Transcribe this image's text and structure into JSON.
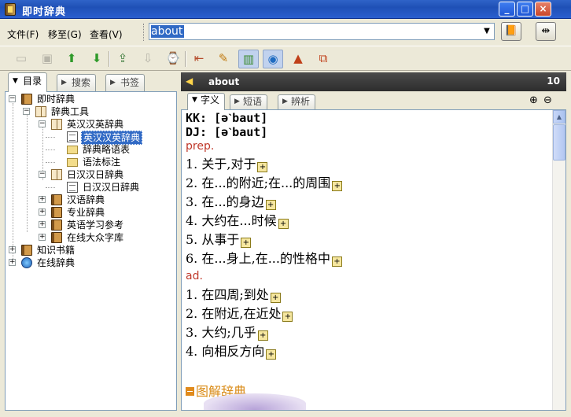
{
  "window": {
    "title": "即时辞典"
  },
  "menu": {
    "file": "文件(F)",
    "move": "移至(G)",
    "view": "查看(V)"
  },
  "search": {
    "value": "about"
  },
  "toolbar_icons": [
    "save-icon",
    "cut-icon",
    "up-arrow-icon",
    "down-arrow-icon",
    "export-icon",
    "import-icon",
    "history-icon",
    "find-icon",
    "note-icon",
    "book-view-icon",
    "globe-icon",
    "pdf-icon",
    "dictionary-manage-icon"
  ],
  "left_tabs": [
    "目录",
    "搜索",
    "书签"
  ],
  "tree": {
    "root": "即时辞典",
    "tools": "辞典工具",
    "ce_dict_group": "英汉汉英辞典",
    "ce_dict": "英汉汉英辞典",
    "abbrev": "辞典略语表",
    "grammar": "语法标注",
    "jp_group": "日汉汉日辞典",
    "jp_dict": "日汉汉日辞典",
    "cn_dict": "汉语辞典",
    "pro_dict": "专业辞典",
    "study": "英语学习参考",
    "online_lib": "在线大众字库",
    "knowledge": "知识书籍",
    "online": "在线辞典"
  },
  "entry": {
    "word": "about",
    "count": "10",
    "tabs": [
      "字义",
      "短语",
      "辨析"
    ],
    "kk": "KK: [əˋbaut]",
    "dj": "DJ: [əˋbaut]",
    "pos1": "prep.",
    "defs1": [
      "1. 关于,对于",
      "2. 在...的附近;在...的周围",
      "3. 在...的身边",
      "4. 大约在...时候",
      "5. 从事于",
      "6. 在...身上,在...的性格中"
    ],
    "pos2": "ad.",
    "defs2": [
      "1. 在四周;到处",
      "2. 在附近,在近处",
      "3. 大约;几乎",
      "4. 向相反方向"
    ],
    "section": "图解辞典"
  }
}
